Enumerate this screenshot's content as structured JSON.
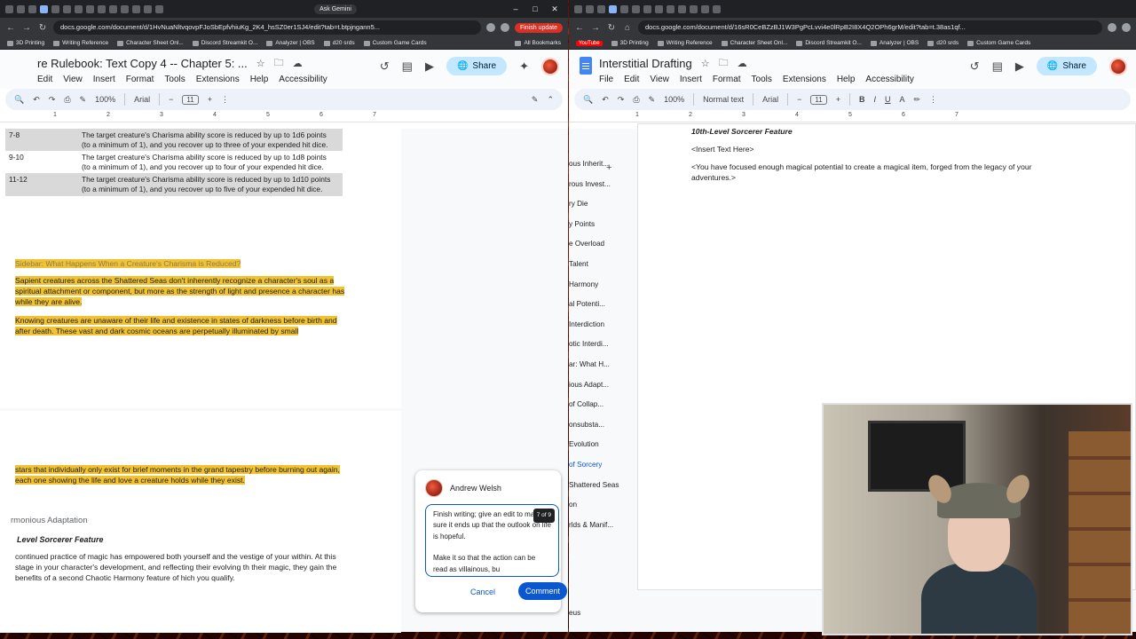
{
  "left_browser": {
    "ask_label": "Ask Gemini",
    "url": "docs.google.com/document/d/1HvNuaNltvqovpFJoSbEpfvhiuKg_2K4_hsSZ0er1SJ4/edit?tab=t.btpjngann5...",
    "update_label": "Finish update",
    "bookmarks": [
      "3D Printing",
      "Writing Reference",
      "Character Sheet Onl...",
      "Discord Streamkit O...",
      "Analyzer | OBS",
      "d20 srds",
      "Custom Game Cards"
    ],
    "all_bookmarks": "All Bookmarks"
  },
  "left_doc": {
    "title": "re Rulebook: Text Copy 4 -- Chapter 5: ...",
    "menus": [
      "Edit",
      "View",
      "Insert",
      "Format",
      "Tools",
      "Extensions",
      "Help",
      "Accessibility"
    ],
    "share_label": "Share",
    "zoom": "100%",
    "font": "Arial",
    "font_size": "11",
    "ruler_ticks": [
      "1",
      "2",
      "3",
      "4",
      "5",
      "6",
      "7"
    ],
    "table_rows": [
      {
        "range": "7-8",
        "text": "The target creature's Charisma ability score is reduced by up to 1d6 points (to a minimum of 1), and you recover up to three of your expended hit dice."
      },
      {
        "range": "9-10",
        "text": "The target creature's Charisma ability score is reduced by up to 1d8 points (to a minimum of 1), and you recover up to four of your expended hit dice."
      },
      {
        "range": "11-12",
        "text": "The target creature's Charisma ability score is reduced by up to 1d10 points (to a minimum of 1), and you recover up to five of your expended hit dice."
      }
    ],
    "sidebar_title": "Sidebar: What Happens When a Creature's Charisma is Reduced?",
    "para1": "Sapient creatures across the Shattered Seas don't inherently recognize a character's soul as a spiritual attachment or component, but more as the strength of light and presence a character has while they are alive.",
    "para2": "Knowing creatures are unaware of their life and existence in states of darkness before birth and after death.  These vast and dark cosmic oceans are perpetually illuminated by small",
    "para3": "stars that individually only exist for brief moments in the grand tapestry before burning out again, each one showing the life and love a creature holds while they exist.",
    "heading": "rmonious Adaptation",
    "feature": "Level Sorcerer Feature",
    "para4": "continued practice of magic has empowered both yourself and the vestige of your within.  At this stage in your character's development, and reflecting their evolving th their magic, they gain the benefits of a second Chaotic Harmony feature of hich you qualify."
  },
  "comment": {
    "author": "Andrew Welsh",
    "counter": "7 of 9",
    "text1": "Finish writing; give an edit to make sure it ends up that the outlook on life is hopeful.",
    "text2": "Make it so that the action can be read as villainous, bu",
    "cancel": "Cancel",
    "submit": "Comment"
  },
  "outline": {
    "items": [
      "ous Inherit...",
      "rous Invest...",
      "ry Die",
      "y Points",
      "e Overload",
      "Talent",
      "Harmony",
      "al Potenti...",
      "Interdiction",
      "otic Interdi...",
      "ar: What H...",
      "ious Adapt...",
      "of Collap...",
      "onsubsta...",
      "Evolution",
      "of Sorcery",
      "Shattered Seas",
      "on",
      "rlds & Manif..."
    ],
    "active_index": 15,
    "footer": "eus"
  },
  "right_browser": {
    "url": "docs.google.com/document/d/16sR0CeBZzBJ1W3PgPcLvvi4e0lRpB2I8X4Q2OPh6grM/edit?tab=t.38as1qf...",
    "bookmarks": [
      "3D Printing",
      "Writing Reference",
      "Character Sheet Onl...",
      "Discord Streamkit O...",
      "Analyzer | OBS",
      "d20 srds",
      "Custom Game Cards"
    ],
    "youtube": "YouTube"
  },
  "right_doc": {
    "title": "Interstitial Drafting",
    "menus": [
      "File",
      "Edit",
      "View",
      "Insert",
      "Format",
      "Tools",
      "Extensions",
      "Help",
      "Accessibility"
    ],
    "share_label": "Share",
    "zoom": "100%",
    "style": "Normal text",
    "font": "Arial",
    "font_size": "11",
    "ruler_ticks": [
      "1",
      "2",
      "3",
      "4",
      "5",
      "6",
      "7"
    ],
    "feature_heading": "10th-Level Sorcerer Feature",
    "placeholder": "<Insert Text Here>",
    "body": "<You have focused enough magical potential to create a magical item, forged from the legacy of your adventures.>"
  }
}
